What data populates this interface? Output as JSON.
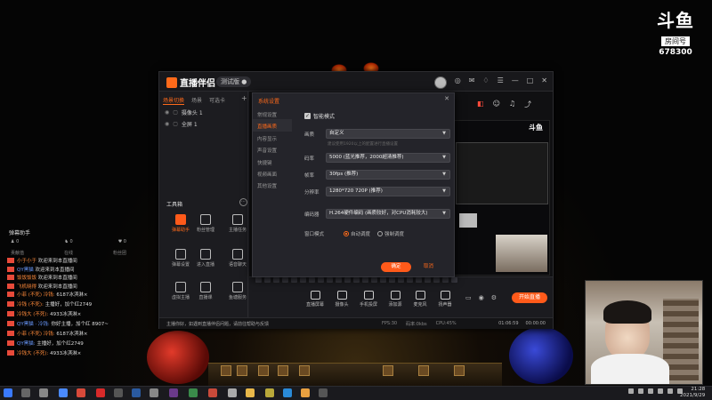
{
  "watermark": {
    "mark": "斗鱼",
    "room_label": "房间号",
    "room_number": "678300"
  },
  "app": {
    "title": "直播伴侣",
    "version_pill": "测试版 ●",
    "scene_tabs": [
      "场景切换",
      "场景",
      "可选卡"
    ],
    "sources": [
      "摄像头 1",
      "全屏 1"
    ],
    "tools_heading": "工具箱",
    "tools": [
      {
        "label": "弹幕助手",
        "hot": true
      },
      {
        "label": "粉丝管理",
        "hot": false
      },
      {
        "label": "主播任务",
        "hot": false
      },
      {
        "label": "弹幕设置",
        "hot": false
      },
      {
        "label": "进入直播",
        "hot": false
      },
      {
        "label": "语音聊天",
        "hot": false
      },
      {
        "label": "虚拟主播",
        "hot": false
      },
      {
        "label": "直播课",
        "hot": false
      },
      {
        "label": "鱼塘服务",
        "hot": false
      }
    ]
  },
  "dialog": {
    "title": "系统设置",
    "nav": [
      "常规设置",
      "直播画质",
      "内容显示",
      "声音设置",
      "快捷键",
      "视频画面",
      "其他设置"
    ],
    "active_nav": 1,
    "smart_mode": "智能模式",
    "fields": [
      {
        "label": "画质",
        "value": "自定义",
        "hint": "建议使用1920以上的配置进行直播设置"
      },
      {
        "label": "码率",
        "value": "5000 (蓝光推荐，2000超清推荐)",
        "hint": ""
      },
      {
        "label": "帧率",
        "value": "30fps (推荐)",
        "hint": ""
      },
      {
        "label": "分辨率",
        "value": "1280*720 720P (推荐)",
        "hint": ""
      },
      {
        "label": "编码器",
        "value": "H.264硬件编码 (画质较好，对CPU消耗较大)",
        "hint": ""
      }
    ],
    "radio_label": "窗口模式",
    "radio_options": [
      "自动调度",
      "强制调度"
    ],
    "ok_label": "确定",
    "cancel_label": "取消"
  },
  "bottom_toolbar": {
    "buttons": [
      "直播屏幕",
      "摄像头",
      "手机投屏",
      "添加源",
      "麦克风",
      "扬声器"
    ],
    "live_button": "开始直播",
    "status_message": "主播你好，如遇到直播伴侣问题，请前往帮助与反馈",
    "stats": [
      "FPS:30",
      "码率:0kbs",
      "CPU:45%"
    ],
    "times": [
      "01:06:59",
      "00:00:00"
    ]
  },
  "chat": {
    "title": "弹幕助手",
    "stats": [
      "0",
      "0",
      "0"
    ],
    "sub_tabs": [
      "贡献值",
      "在线",
      "粉丝团"
    ],
    "lines": [
      {
        "user": "小于小于",
        "text": "欢迎来到本直播间",
        "color": "orange"
      },
      {
        "user": "QY黑猫",
        "text": "欢迎来到本直播间",
        "color": "blue"
      },
      {
        "user": "饭饭饭饭",
        "text": "欢迎来到本直播间",
        "color": "orange"
      },
      {
        "user": "飞机晓得",
        "text": "欢迎来到本直播间",
        "color": "orange"
      },
      {
        "user": "小菲 (不死) 冷钱:",
        "text": "6187冰淇淋×",
        "color": "orange"
      },
      {
        "user": "冷钱 (不死):",
        "text": "主播好，加个红2749",
        "color": "orange"
      },
      {
        "user": "冷钱大 (不死):",
        "text": "4933冰淇淋×",
        "color": "orange"
      },
      {
        "user": "QY黑猫 · 冷钱:",
        "text": "你好主播，加个红 8907~",
        "color": "blue"
      },
      {
        "user": "小菲 (不死) 冷钱:",
        "text": "6187冰淇淋×",
        "color": "orange"
      },
      {
        "user": "QY黑猫:",
        "text": "主播好，加个红2749",
        "color": "blue"
      },
      {
        "user": "冷钱大 (不死):",
        "text": "4933冰淇淋×",
        "color": "orange"
      }
    ]
  },
  "stream_preview": {
    "logo": "斗鱼"
  },
  "clock": {
    "time": "21:28",
    "date": "2021/9/29"
  },
  "colors": {
    "accent": "#ff5a1a",
    "bg": "#050505",
    "panel": "#1f1f23"
  }
}
